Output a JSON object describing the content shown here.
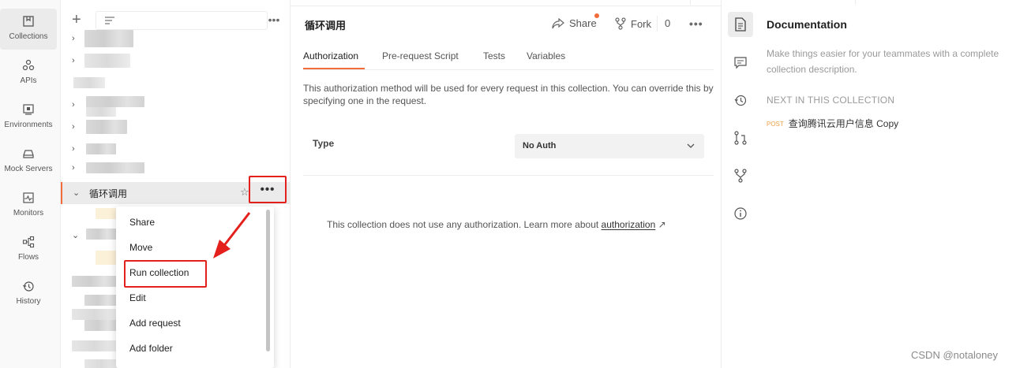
{
  "rail": {
    "items": [
      {
        "label": "Collections",
        "icon": "collections-icon",
        "active": true
      },
      {
        "label": "APIs",
        "icon": "apis-icon"
      },
      {
        "label": "Environments",
        "icon": "environments-icon"
      },
      {
        "label": "Mock Servers",
        "icon": "mock-servers-icon"
      },
      {
        "label": "Monitors",
        "icon": "monitors-icon"
      },
      {
        "label": "Flows",
        "icon": "flows-icon"
      },
      {
        "label": "History",
        "icon": "history-icon"
      }
    ]
  },
  "sidebar": {
    "new_icon": "plus-icon",
    "filter_icon": "filter-icon",
    "more_icon": "more-icon",
    "selected_collection": "循环调用"
  },
  "context_menu": {
    "items": [
      "Share",
      "Move",
      "Run collection",
      "Edit",
      "Add request",
      "Add folder"
    ]
  },
  "main": {
    "title": "循环调用",
    "share_label": "Share",
    "fork_label": "Fork",
    "fork_count": "0",
    "tabs": [
      "Authorization",
      "Pre-request Script",
      "Tests",
      "Variables"
    ],
    "active_tab": "Authorization",
    "description": "This authorization method will be used for every request in this collection. You can override this by specifying one in the request.",
    "type_label": "Type",
    "type_value": "No Auth",
    "no_auth_text": "This collection does not use any authorization. Learn more about ",
    "no_auth_link": "authorization",
    "no_auth_link_suffix": " ↗"
  },
  "right_panel": {
    "title": "Documentation",
    "description": "Make things easier for your teammates with a complete collection description.",
    "next_heading": "NEXT IN THIS COLLECTION",
    "next_item_method": "POST",
    "next_item_name": "查询腾讯云用户信息 Copy"
  },
  "watermark": "CSDN @notaloney",
  "colors": {
    "accent": "#f26b3a",
    "highlight": "#e3201b"
  }
}
